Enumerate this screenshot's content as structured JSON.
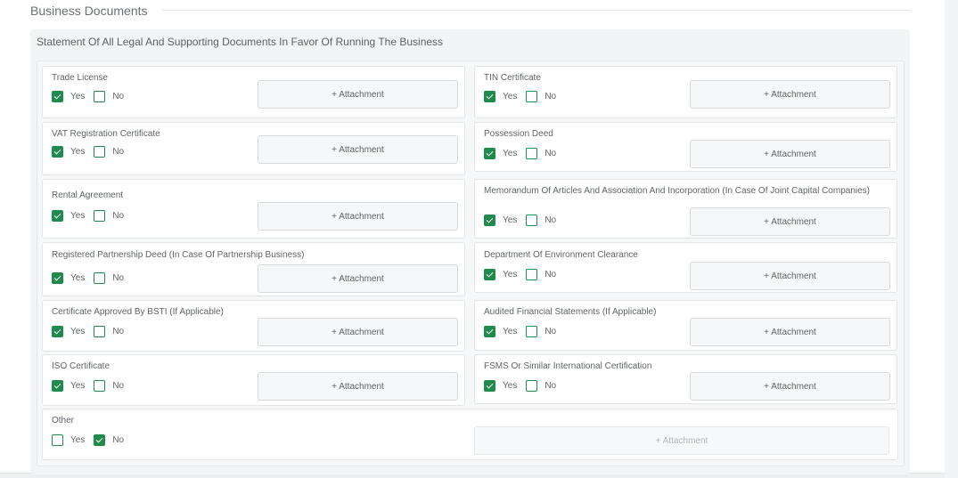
{
  "section": {
    "title": "Business Documents"
  },
  "panel": {
    "title": "Statement Of All Legal And Supporting Documents In Favor Of Running The Business"
  },
  "options": {
    "yes": "Yes",
    "no": "No"
  },
  "attachment_label": "+ Attachment",
  "colors": {
    "accent": "#1f8a4c"
  },
  "documents": [
    {
      "label": "Trade License",
      "yes": true
    },
    {
      "label": "TIN Certificate",
      "yes": true
    },
    {
      "label": "VAT Registration Certificate",
      "yes": true
    },
    {
      "label": "Possession Deed",
      "yes": true
    },
    {
      "label": "Rental Agreement",
      "yes": true
    },
    {
      "label": "Memorandum Of Articles And Association And Incorporation (In Case Of Joint Capital Companies)",
      "yes": true
    },
    {
      "label": "Registered Partnership Deed (In Case Of Partnership Business)",
      "yes": true
    },
    {
      "label": "Department Of Environment Clearance",
      "yes": true
    },
    {
      "label": "Certificate Approved By BSTI (If Applicable)",
      "yes": true
    },
    {
      "label": "Audited Financial Statements (If Applicable)",
      "yes": true
    },
    {
      "label": "ISO Certificate",
      "yes": true
    },
    {
      "label": "FSMS Or Similar International Certification",
      "yes": true
    },
    {
      "label": "Other",
      "yes": false,
      "attachment_disabled": true
    }
  ]
}
